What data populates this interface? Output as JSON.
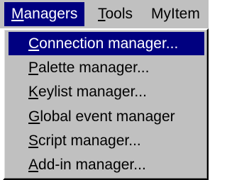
{
  "menubar": {
    "items": [
      {
        "first": "M",
        "rest": "anagers"
      },
      {
        "first": "T",
        "rest": "ools"
      },
      {
        "label": "MyItem"
      }
    ]
  },
  "dropdown": {
    "items": [
      {
        "first": "C",
        "rest": "onnection manager..."
      },
      {
        "first": "P",
        "rest": "alette manager..."
      },
      {
        "first": "K",
        "rest": "eylist manager..."
      },
      {
        "first": "G",
        "rest": "lobal event manager"
      },
      {
        "first": "S",
        "rest": "cript manager..."
      },
      {
        "first": "A",
        "rest": "dd-in manager..."
      }
    ]
  },
  "colors": {
    "face": "#c0c0c0",
    "highlight": "#000080",
    "highlight_text": "#ffffff"
  }
}
